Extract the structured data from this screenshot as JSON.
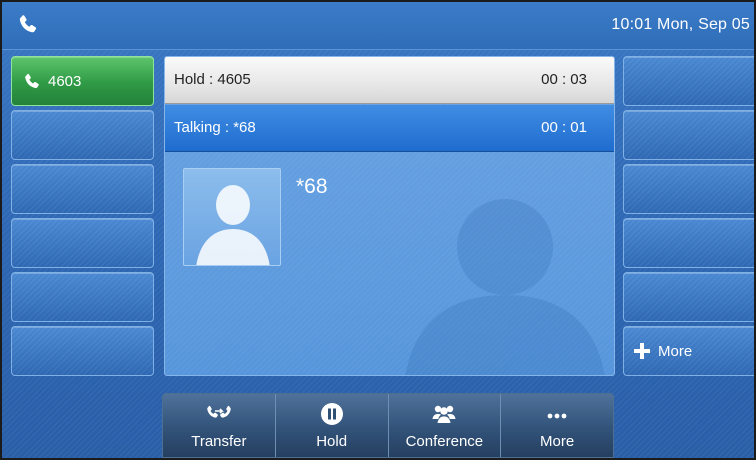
{
  "status_bar": {
    "icon": "phone-icon",
    "datetime": "10:01 Mon, Sep 05"
  },
  "line_keys": {
    "active_line": {
      "icon": "phone-handset-icon",
      "label": "4603",
      "color": "#2f9a45"
    }
  },
  "calls": {
    "hold": {
      "label": "Hold : 4605",
      "timer": "00 : 03"
    },
    "talking": {
      "label": "Talking : *68",
      "timer": "00 : 01"
    }
  },
  "contact": {
    "name": "*68",
    "photo": "contact-silhouette-icon"
  },
  "right_keys": {
    "more_label": "More",
    "more_icon": "plus-icon"
  },
  "softkeys": [
    {
      "label": "Transfer",
      "icon": "transfer-icon"
    },
    {
      "label": "Hold",
      "icon": "pause-icon"
    },
    {
      "label": "Conference",
      "icon": "conference-icon"
    },
    {
      "label": "More",
      "icon": "ellipsis-icon"
    }
  ],
  "colors": {
    "background": "#2f6cb8",
    "talking_highlight": "#1f6ccf",
    "hold_row": "#e7e7e7",
    "softkey_bar": "#34557c"
  }
}
